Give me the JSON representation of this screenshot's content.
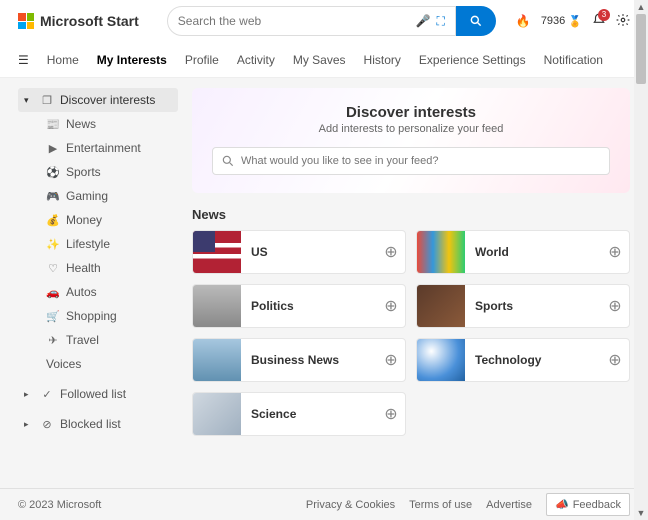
{
  "header": {
    "logo_text": "Microsoft Start",
    "search_placeholder": "Search the web",
    "points": "7936",
    "notification_count": "3"
  },
  "nav": {
    "items": [
      "Home",
      "My Interests",
      "Profile",
      "Activity",
      "My Saves",
      "History",
      "Experience Settings",
      "Notification"
    ],
    "active_index": 1
  },
  "sidebar": {
    "discover": "Discover interests",
    "children": [
      "News",
      "Entertainment",
      "Sports",
      "Gaming",
      "Money",
      "Lifestyle",
      "Health",
      "Autos",
      "Shopping",
      "Travel"
    ],
    "voices": "Voices",
    "followed": "Followed list",
    "blocked": "Blocked list"
  },
  "hero": {
    "title": "Discover interests",
    "subtitle": "Add interests to personalize your feed",
    "search_placeholder": "What would you like to see in your feed?"
  },
  "section_title": "News",
  "cards": [
    "US",
    "World",
    "Politics",
    "Sports",
    "Business News",
    "Technology",
    "Science"
  ],
  "card_thumbs": [
    "us",
    "world",
    "politics",
    "sports",
    "biz",
    "tech",
    "sci"
  ],
  "footer": {
    "copyright": "© 2023 Microsoft",
    "links": [
      "Privacy & Cookies",
      "Terms of use",
      "Advertise"
    ],
    "feedback": "Feedback"
  }
}
